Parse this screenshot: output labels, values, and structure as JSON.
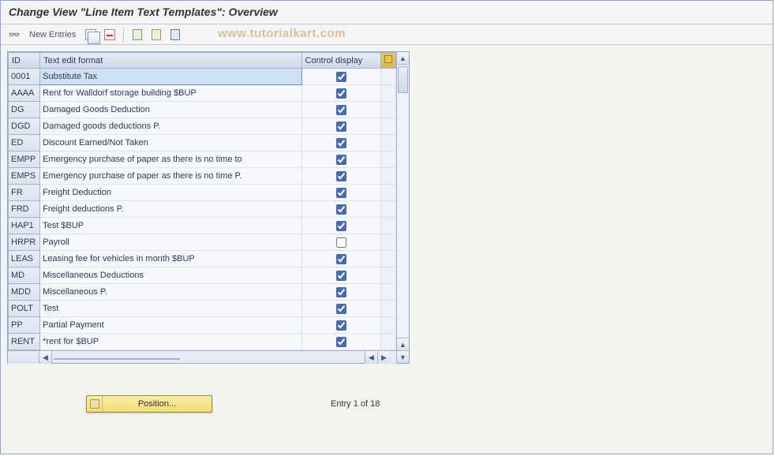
{
  "title": "Change View \"Line Item Text Templates\": Overview",
  "toolbar": {
    "new_entries_label": "New Entries"
  },
  "watermark": "www.tutorialkart.com",
  "columns": {
    "id": "ID",
    "text": "Text edit format",
    "ctrl": "Control display"
  },
  "rows": [
    {
      "id": "0001",
      "text": "Substitute Tax",
      "ctrl": true,
      "selected": true
    },
    {
      "id": "AAAA",
      "text": "Rent for Walldorf storage building $BUP",
      "ctrl": true
    },
    {
      "id": "DG",
      "text": "Damaged Goods Deduction",
      "ctrl": true
    },
    {
      "id": "DGD",
      "text": "Damaged goods deductions P.",
      "ctrl": true
    },
    {
      "id": "ED",
      "text": "Discount Earned/Not Taken",
      "ctrl": true
    },
    {
      "id": "EMPP",
      "text": "Emergency purchase of paper as there is no time to",
      "ctrl": true
    },
    {
      "id": "EMPS",
      "text": "Emergency purchase of paper as there is no time P.",
      "ctrl": true
    },
    {
      "id": "FR",
      "text": "Freight Deduction",
      "ctrl": true
    },
    {
      "id": "FRD",
      "text": "Freight deductions P.",
      "ctrl": true
    },
    {
      "id": "HAP1",
      "text": "Test $BUP",
      "ctrl": true
    },
    {
      "id": "HRPR",
      "text": "Payroll",
      "ctrl": false
    },
    {
      "id": "LEAS",
      "text": "Leasing fee for vehicles in month $BUP",
      "ctrl": true
    },
    {
      "id": "MD",
      "text": "Miscellaneous Deductions",
      "ctrl": true
    },
    {
      "id": "MDD",
      "text": "Miscellaneous P.",
      "ctrl": true
    },
    {
      "id": "POLT",
      "text": "Test",
      "ctrl": true
    },
    {
      "id": "PP",
      "text": "Partial Payment",
      "ctrl": true
    },
    {
      "id": "RENT",
      "text": "*rent for $BUP",
      "ctrl": true
    }
  ],
  "footer": {
    "position_label": "Position...",
    "entry_label": "Entry 1 of 18"
  },
  "icons": {
    "glasses": "glasses-icon",
    "copy": "copy-icon",
    "delete": "delete-icon",
    "select_all": "select-all-icon",
    "deselect_all": "deselect-all-icon",
    "config": "configure-icon",
    "corner": "table-settings-icon",
    "scroll_up": "▲",
    "scroll_down": "▼",
    "scroll_left": "◀",
    "scroll_right": "▶"
  }
}
